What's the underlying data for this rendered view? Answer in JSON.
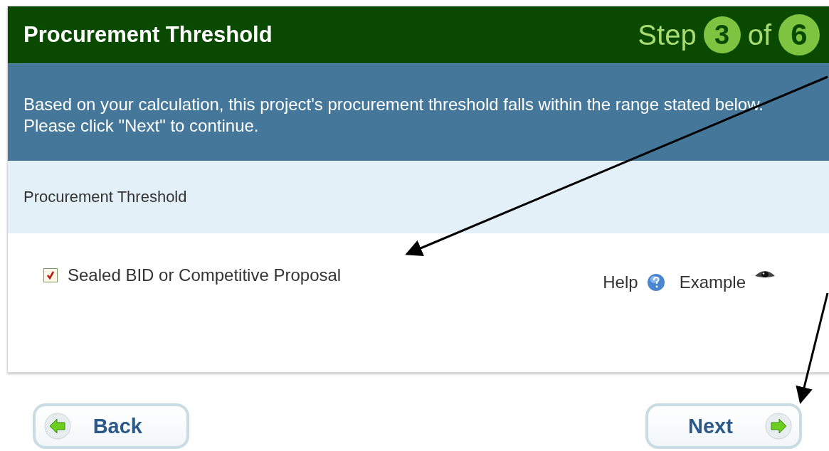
{
  "header": {
    "title": "Procurement Threshold",
    "step_word": "Step",
    "current_step": "3",
    "of_word": "of",
    "total_steps": "6"
  },
  "instructions": "Based on your calculation, this project's procurement threshold falls within the range stated below. Please click \"Next\" to continue.",
  "section": {
    "title": "Procurement Threshold"
  },
  "options": [
    {
      "label": "Sealed BID or Competitive Proposal",
      "checked": true
    }
  ],
  "help_link": "Help",
  "example_link": "Example",
  "buttons": {
    "back": "Back",
    "next": "Next"
  }
}
